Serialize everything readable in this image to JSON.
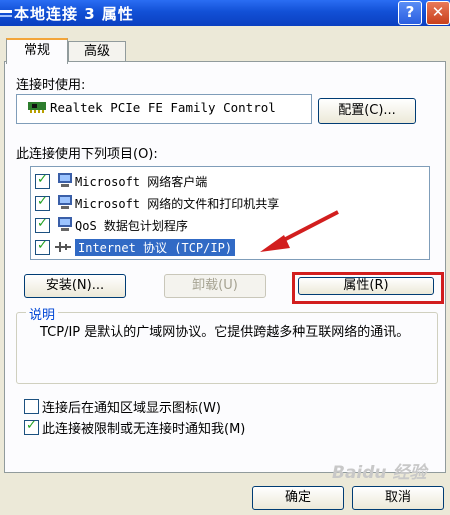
{
  "window": {
    "title": "本地连接 3 属性",
    "help_glyph": "?",
    "close_glyph": "✕"
  },
  "tabs": [
    {
      "label": "常规",
      "active": true
    },
    {
      "label": "高级",
      "active": false
    }
  ],
  "connect_using": {
    "label": "连接时使用:",
    "adapter": "Realtek PCIe FE Family Control",
    "configure_button": "配置(C)..."
  },
  "components": {
    "label": "此连接使用下列项目(O):",
    "items": [
      {
        "label": "Microsoft 网络客户端",
        "checked": true,
        "selected": false
      },
      {
        "label": "Microsoft 网络的文件和打印机共享",
        "checked": true,
        "selected": false
      },
      {
        "label": "QoS 数据包计划程序",
        "checked": true,
        "selected": false
      },
      {
        "label": "Internet 协议 (TCP/IP)",
        "checked": true,
        "selected": true
      }
    ]
  },
  "actions": {
    "install": "安装(N)...",
    "uninstall": "卸载(U)",
    "properties": "属性(R)"
  },
  "description": {
    "title": "说明",
    "text": "TCP/IP 是默认的广域网协议。它提供跨越多种互联网络的通讯。"
  },
  "options": {
    "show_icon": {
      "label": "连接后在通知区域显示图标(W)",
      "checked": false
    },
    "notify": {
      "label": "此连接被限制或无连接时通知我(M)",
      "checked": true
    }
  },
  "footer": {
    "ok": "确定",
    "cancel": "取消"
  },
  "watermark": "Baidu 经验",
  "colors": {
    "titlebar": "#1250d6",
    "selection": "#316ac5",
    "highlight_box": "#d21e1e",
    "arrow": "#d21e1e"
  }
}
